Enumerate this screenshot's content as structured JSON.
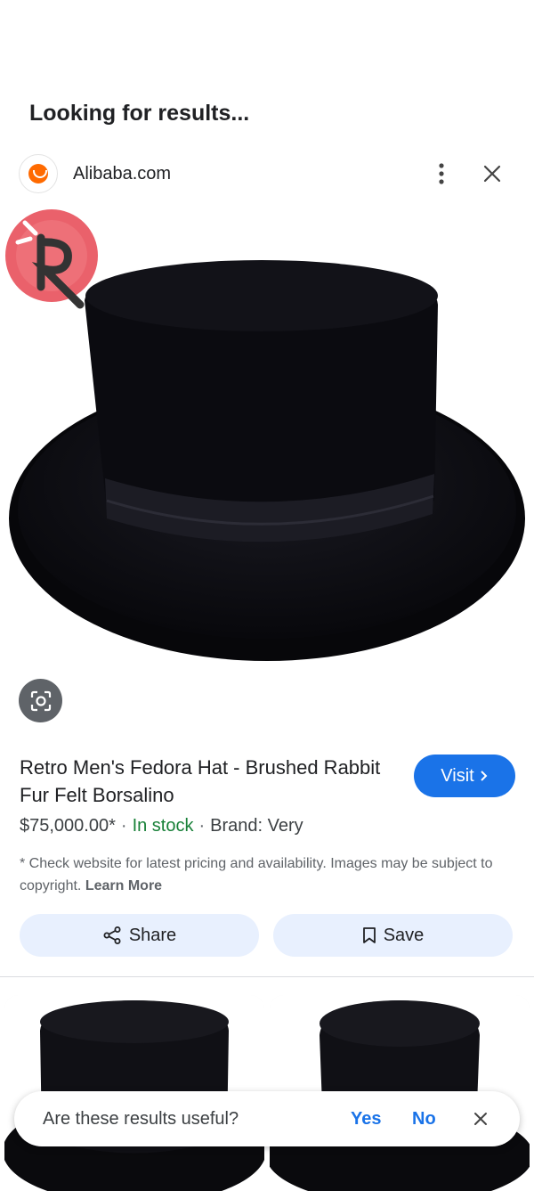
{
  "status": {
    "text": "Looking for results..."
  },
  "source": {
    "name": "Alibaba.com",
    "logo_icon": "alibaba-logo-icon",
    "more_icon": "more-vert-icon",
    "close_icon": "close-icon"
  },
  "product": {
    "title": "Retro Men's Fedora Hat - Brushed Rabbit Fur Felt Borsalino",
    "price": "$75,000.00*",
    "stock": "In stock",
    "brand": "Brand: Very",
    "disclaimer": "* Check website for latest pricing and availability. Images may be subject to copyright.",
    "learn_more": "Learn More"
  },
  "actions": {
    "visit_label": "Visit",
    "share_label": "Share",
    "save_label": "Save"
  },
  "feedback": {
    "question": "Are these results useful?",
    "yes_label": "Yes",
    "no_label": "No"
  },
  "colors": {
    "accent": "#1a73e8",
    "in_stock": "#188038",
    "button_bg": "#e8f0fe",
    "alibaba": "#ff6a00"
  }
}
